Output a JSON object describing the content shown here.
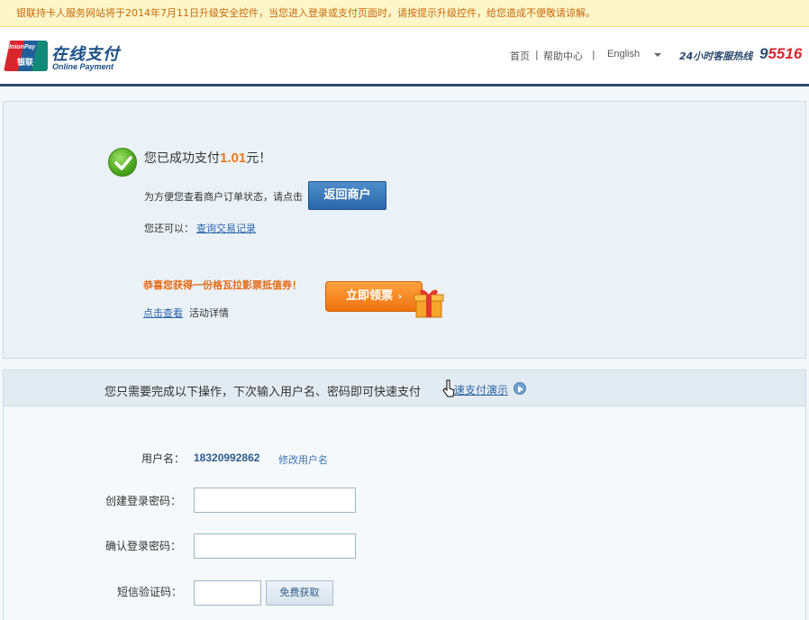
{
  "notice": {
    "text": "银联持卡人服务网站将于2014年7月11日升级安全控件，当您进入登录或支付页面时，请按提示升级控件，给您造成不便敬请谅解。"
  },
  "header": {
    "logo_badge_top": "UnionPay",
    "logo_badge_bottom": "银联",
    "logo_cn": "在线支付",
    "logo_en": "Online Payment",
    "nav": {
      "home": "首页",
      "help": "帮助中心",
      "sep1": "|",
      "sep2": "|"
    },
    "language": "English",
    "hotline_label": "24小时客服热线",
    "hotline_prefix": "9",
    "hotline_rest": "5516"
  },
  "success": {
    "prefix": "您已成功支付",
    "amount": "1.01",
    "suffix": "元！",
    "return_hint": "为方便您查看商户订单状态，请点击",
    "return_button": "返回商户",
    "also_label": "您还可以：",
    "also_link": "查询交易记录",
    "promo_text": "恭喜您获得一份格瓦拉影票抵值券！",
    "detail_link": "点击查看",
    "detail_tail": "活动详情",
    "ticket_button": "立即领票",
    "ticket_arrow": "›"
  },
  "quick_pay": {
    "headline": "您只需要完成以下操作，下次输入用户名、密码即可快速支付",
    "demo_link": "速支付演示",
    "username_label": "用户名：",
    "username_value": "18320992862",
    "username_edit": "修改用户名",
    "create_pwd_label": "创建登录密码：",
    "confirm_pwd_label": "确认登录密码：",
    "sms_label": "短信验证码：",
    "sms_button": "免费获取"
  },
  "colors": {
    "accent_orange": "#e8781a",
    "link_blue": "#2a66a8",
    "brand_navy": "#2d4a6f"
  },
  "icons": [
    "check-icon",
    "gift-icon",
    "cursor-icon",
    "play-icon",
    "chevron-down-icon"
  ]
}
